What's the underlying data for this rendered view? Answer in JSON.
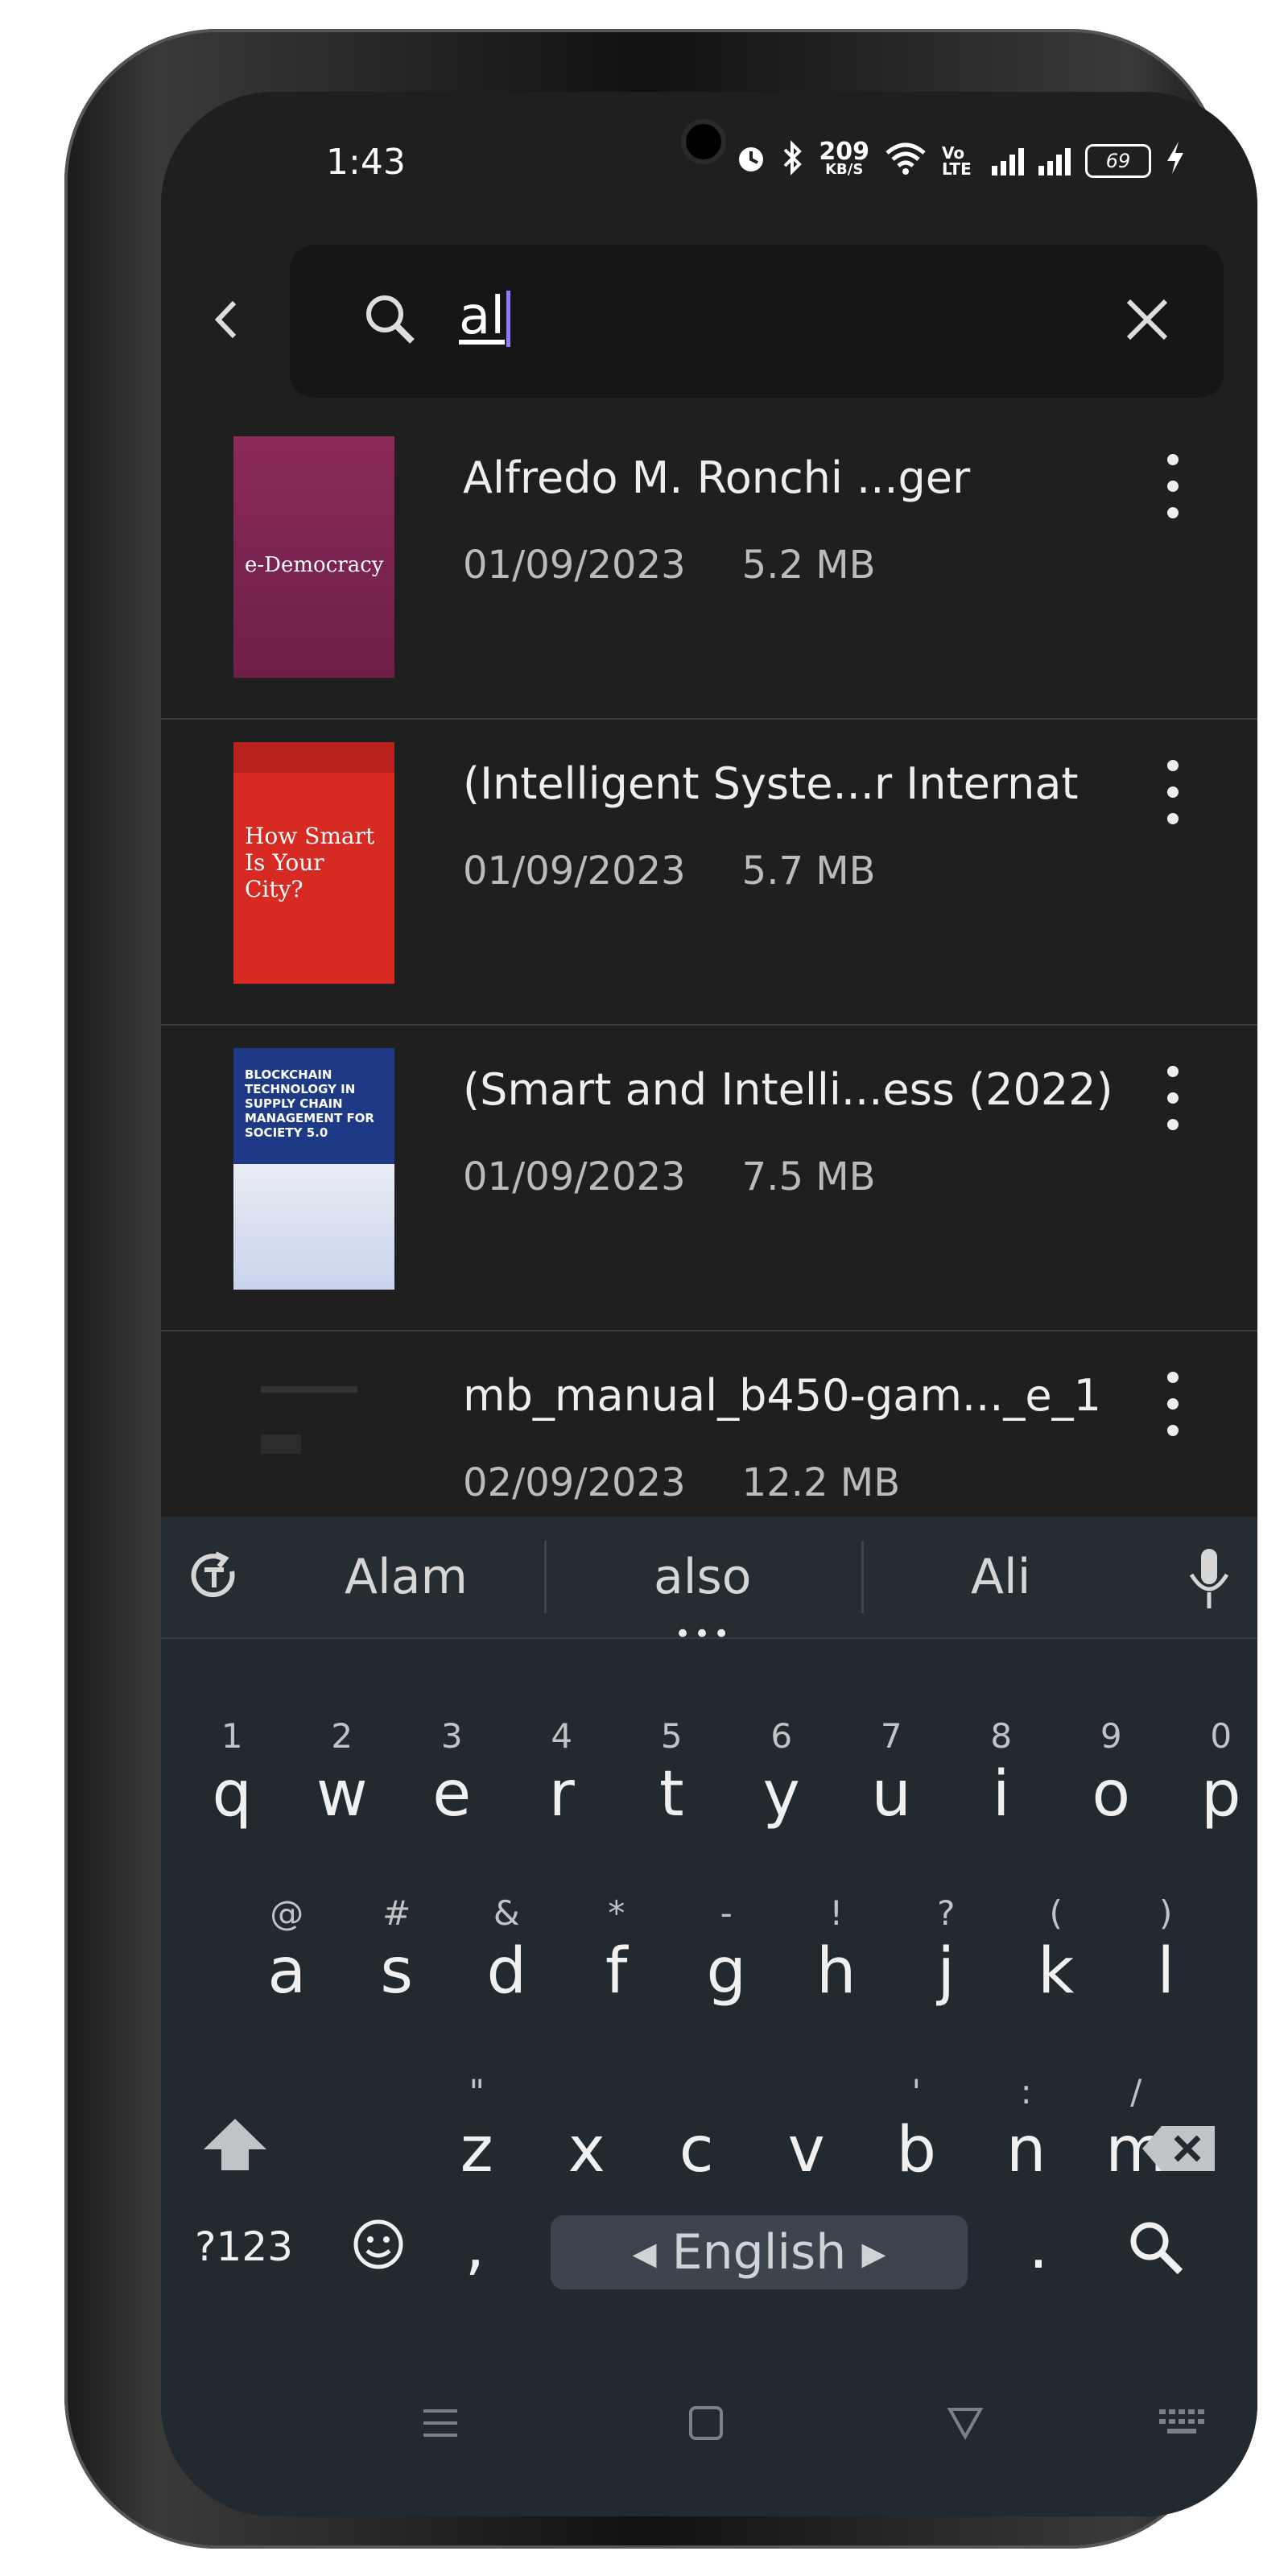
{
  "status_bar": {
    "time": "1:43",
    "net_speed": "209",
    "net_unit": "KB/S",
    "battery": "69",
    "volte": "Vo LTE"
  },
  "search": {
    "query": "al"
  },
  "files": [
    {
      "title": "Alfredo M. Ronchi ...ger",
      "date": "01/09/2023",
      "size": "5.2 MB",
      "cover_text": "e-Democracy"
    },
    {
      "title": "(Intelligent Syste...r Internat",
      "date": "01/09/2023",
      "size": "5.7 MB",
      "cover_text": "How Smart Is Your City?"
    },
    {
      "title": "(Smart and Intelli...ess (2022)",
      "date": "01/09/2023",
      "size": "7.5 MB",
      "cover_text": "BLOCKCHAIN TECHNOLOGY IN SUPPLY CHAIN MANAGEMENT FOR SOCIETY 5.0"
    },
    {
      "title": "mb_manual_b450-gam..._e_1",
      "date": "02/09/2023",
      "size": "12.2 MB",
      "cover_text": ""
    }
  ],
  "keyboard": {
    "suggestions": [
      "Alam",
      "also",
      "Ali"
    ],
    "row1": [
      "q",
      "w",
      "e",
      "r",
      "t",
      "y",
      "u",
      "i",
      "o",
      "p"
    ],
    "row1_alt": [
      "1",
      "2",
      "3",
      "4",
      "5",
      "6",
      "7",
      "8",
      "9",
      "0"
    ],
    "row2": [
      "a",
      "s",
      "d",
      "f",
      "g",
      "h",
      "j",
      "k",
      "l"
    ],
    "row2_alt": [
      "@",
      "#",
      "&",
      "*",
      "-",
      "!",
      "?",
      "(",
      ")"
    ],
    "row3": [
      "z",
      "x",
      "c",
      "v",
      "b",
      "n",
      "m"
    ],
    "row3_alt": [
      "\"",
      "",
      "",
      "",
      "'",
      ":",
      "/"
    ],
    "symbols_label": "?123",
    "comma": ",",
    "period": ".",
    "space_label": "◂ English ▸"
  },
  "colors": {
    "background": "#1f1f1f",
    "keyboard": "#222a30",
    "caret": "#8a7bff"
  }
}
